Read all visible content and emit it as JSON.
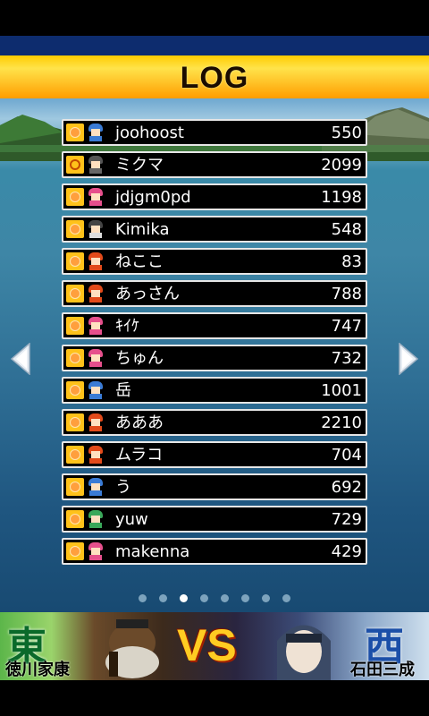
{
  "header": {
    "title": "LOG"
  },
  "entries": [
    {
      "name": "joohoost",
      "score": "550",
      "hair": "#3a7bd5",
      "body": "#3a7bd5",
      "badge": "normal"
    },
    {
      "name": "ミクマ",
      "score": "2099",
      "hair": "#555555",
      "body": "#666666",
      "badge": "target"
    },
    {
      "name": "jdjgm0pd",
      "score": "1198",
      "hair": "#e64f8c",
      "body": "#e64f8c",
      "badge": "normal"
    },
    {
      "name": "Kimika",
      "score": "548",
      "hair": "#444444",
      "body": "#dddddd",
      "badge": "normal"
    },
    {
      "name": "ねここ",
      "score": "83",
      "hair": "#e24a1a",
      "body": "#e24a1a",
      "badge": "normal"
    },
    {
      "name": "あっさん",
      "score": "788",
      "hair": "#e24a1a",
      "body": "#e24a1a",
      "badge": "normal"
    },
    {
      "name": "ｷｲｹ",
      "score": "747",
      "hair": "#e64f8c",
      "body": "#e64f8c",
      "badge": "normal"
    },
    {
      "name": "ちゅん",
      "score": "732",
      "hair": "#e64f8c",
      "body": "#e64f8c",
      "badge": "normal"
    },
    {
      "name": "岳",
      "score": "1001",
      "hair": "#3a7bd5",
      "body": "#3a7bd5",
      "badge": "normal"
    },
    {
      "name": "あああ",
      "score": "2210",
      "hair": "#e24a1a",
      "body": "#e24a1a",
      "badge": "normal"
    },
    {
      "name": "ムラコ",
      "score": "704",
      "hair": "#e24a1a",
      "body": "#e24a1a",
      "badge": "normal"
    },
    {
      "name": "う",
      "score": "692",
      "hair": "#3a7bd5",
      "body": "#3a7bd5",
      "badge": "normal"
    },
    {
      "name": "yuw",
      "score": "729",
      "hair": "#3aa85a",
      "body": "#3aa85a",
      "badge": "normal"
    },
    {
      "name": "makenna",
      "score": "429",
      "hair": "#e64f8c",
      "body": "#e64f8c",
      "badge": "normal"
    }
  ],
  "pager": {
    "count": 8,
    "active_index": 2
  },
  "banner": {
    "left_kanji": "東",
    "left_name": "徳川家康",
    "vs": "VS",
    "right_kanji": "西",
    "right_name": "石田三成"
  },
  "colors": {
    "title_bar_top": "#ffcc00",
    "title_bar_bottom": "#ff9d00",
    "row_border": "#e6e6e6",
    "header_blue": "#0d2c6e"
  }
}
